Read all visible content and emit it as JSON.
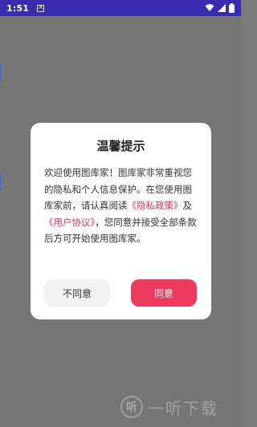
{
  "status_bar": {
    "time": "1:51",
    "app_icon": "A"
  },
  "dialog": {
    "title": "温馨提示",
    "body_intro": "欢迎使用图库家！图库家非常重视您的隐私和个人信息保护。在您使用图库家前，请认真阅读",
    "privacy_link": "《隐私政策》",
    "and_text": "及",
    "agreement_link": "《用户协议》",
    "body_outro": "，您同意并接受全部条款后方可开始使用图库家。",
    "decline_label": "不同意",
    "accept_label": "同意",
    "colors": {
      "accent": "#ee3a5e",
      "link": "#e0335c"
    }
  },
  "watermark": {
    "logo_char": "听",
    "text": "一听下载"
  },
  "icons": [
    "wifi-icon",
    "signal-icon",
    "battery-icon",
    "app-notification-icon"
  ]
}
